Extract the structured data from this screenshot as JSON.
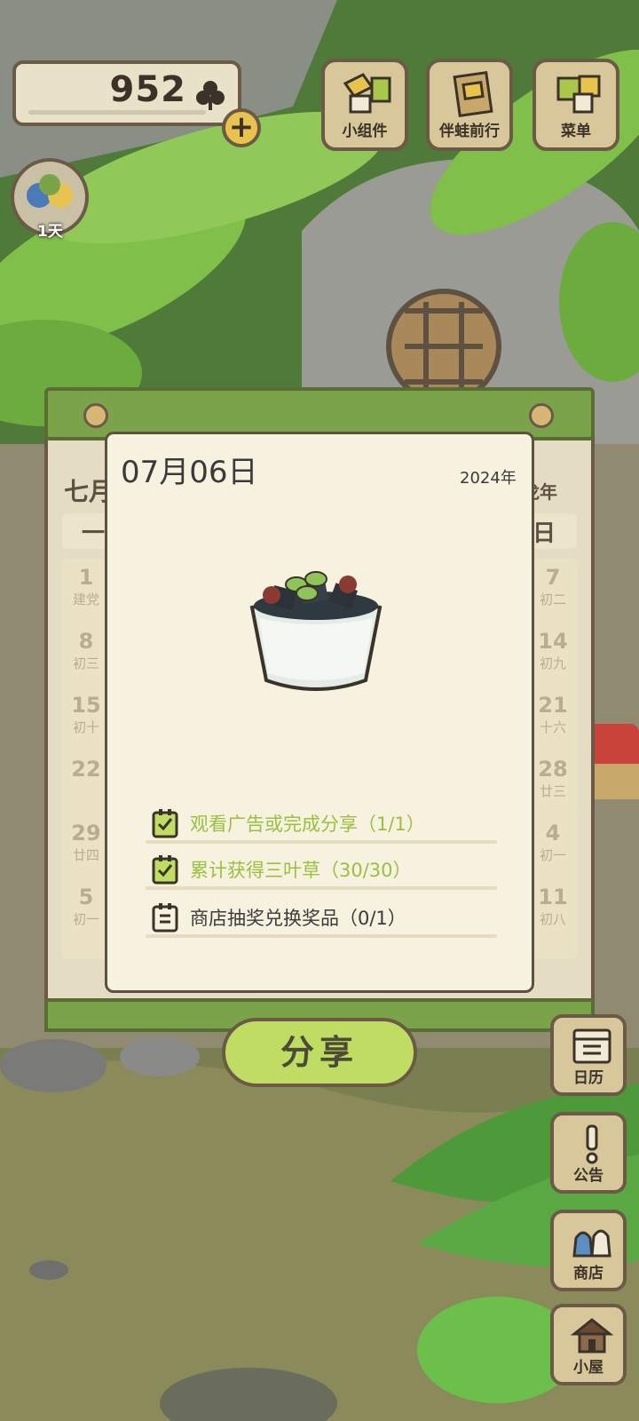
{
  "top": {
    "clover_count": "952",
    "buttons": [
      {
        "label": "小组件"
      },
      {
        "label": "伴蛙前行"
      },
      {
        "label": "菜单"
      }
    ],
    "days_label": "1天"
  },
  "calendar": {
    "month": "七月",
    "year_tag": "龙年",
    "weekday_first": "一",
    "weekday_last": "日",
    "left_days": [
      "1",
      "8",
      "15",
      "22",
      "29",
      "5"
    ],
    "left_sub": [
      "建党",
      "初三",
      "初十",
      "",
      "廿四",
      "初一"
    ],
    "right_days": [
      "7",
      "14",
      "21",
      "28",
      "4",
      "11"
    ],
    "right_sub": [
      "初二",
      "初九",
      "十六",
      "廿三",
      "初一",
      "初八"
    ]
  },
  "popup": {
    "date": "07月06日",
    "year": "2024年",
    "item_icon": "grass-jelly-dessert-icon",
    "tasks": [
      {
        "text": "观看广告或完成分享（1/1）",
        "done": true,
        "icon": "checked-notepad-icon"
      },
      {
        "text": "累计获得三叶草（30/30）",
        "done": true,
        "icon": "checked-notepad-icon"
      },
      {
        "text": "商店抽奖兑换奖品（0/1）",
        "done": false,
        "icon": "unchecked-notepad-icon"
      }
    ],
    "share_label": "分享"
  },
  "side": [
    {
      "label": "日历",
      "icon": "calendar-icon"
    },
    {
      "label": "公告",
      "icon": "exclamation-icon"
    },
    {
      "label": "商店",
      "icon": "bags-icon"
    },
    {
      "label": "小屋",
      "icon": "house-icon"
    }
  ],
  "colors": {
    "done_green": "#9cbf3f",
    "share_button": "#bfdd63",
    "card_bg": "#f7f1df",
    "wood_brown": "#6b5a45"
  }
}
